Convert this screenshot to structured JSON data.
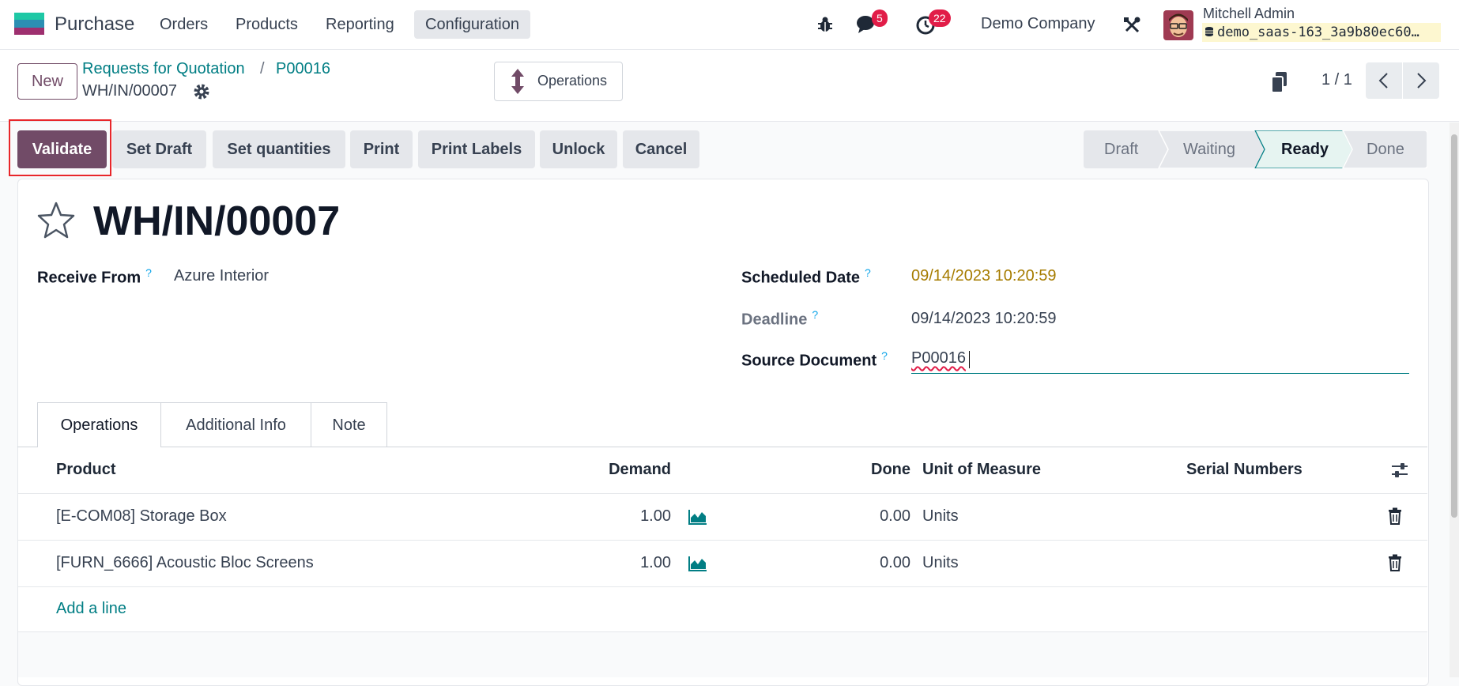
{
  "navbar": {
    "app_name": "Purchase",
    "menu": [
      {
        "label": "Orders"
      },
      {
        "label": "Products"
      },
      {
        "label": "Reporting"
      },
      {
        "label": "Configuration",
        "active": true
      }
    ],
    "messages_badge": "5",
    "activities_badge": "22",
    "company": "Demo Company",
    "user_name": "Mitchell Admin",
    "database": "demo_saas-163_3a9b80ec60…",
    "icons": [
      "bug-icon",
      "chat-icon",
      "clock-icon",
      "tools-icon",
      "database-icon"
    ]
  },
  "control_panel": {
    "new_label": "New",
    "breadcrumb": [
      "Requests for Quotation",
      "P00016"
    ],
    "breadcrumb_separator": "/",
    "record_name": "WH/IN/00007",
    "operations_label": "Operations",
    "pager": "1 / 1"
  },
  "actions": {
    "validate": "Validate",
    "set_draft": "Set Draft",
    "set_quantities": "Set quantities",
    "print": "Print",
    "print_labels": "Print Labels",
    "unlock": "Unlock",
    "cancel": "Cancel"
  },
  "stages": {
    "items": [
      "Draft",
      "Waiting",
      "Ready",
      "Done"
    ],
    "current": "Ready"
  },
  "form": {
    "title": "WH/IN/00007",
    "receive_from_label": "Receive From",
    "receive_from_value": "Azure Interior",
    "scheduled_date_label": "Scheduled Date",
    "scheduled_date_value": "09/14/2023 10:20:59",
    "deadline_label": "Deadline",
    "deadline_value": "09/14/2023 10:20:59",
    "source_document_label": "Source Document",
    "source_document_value": "P00016",
    "help_mark": "?"
  },
  "notebook": {
    "tabs": [
      "Operations",
      "Additional Info",
      "Note"
    ],
    "active_tab": "Operations"
  },
  "moves_table": {
    "headers": {
      "product": "Product",
      "demand": "Demand",
      "done": "Done",
      "uom": "Unit of Measure",
      "serial": "Serial Numbers"
    },
    "rows": [
      {
        "product": "[E-COM08] Storage Box",
        "demand": "1.00",
        "done": "0.00",
        "uom": "Units"
      },
      {
        "product": "[FURN_6666] Acoustic Bloc Screens",
        "demand": "1.00",
        "done": "0.00",
        "uom": "Units"
      }
    ],
    "add_line": "Add a line"
  },
  "colors": {
    "brand": "#714b67",
    "link": "#017e84",
    "warning_date": "#a67c00",
    "badge": "#e11d48",
    "highlight_box": "#e8262a"
  }
}
